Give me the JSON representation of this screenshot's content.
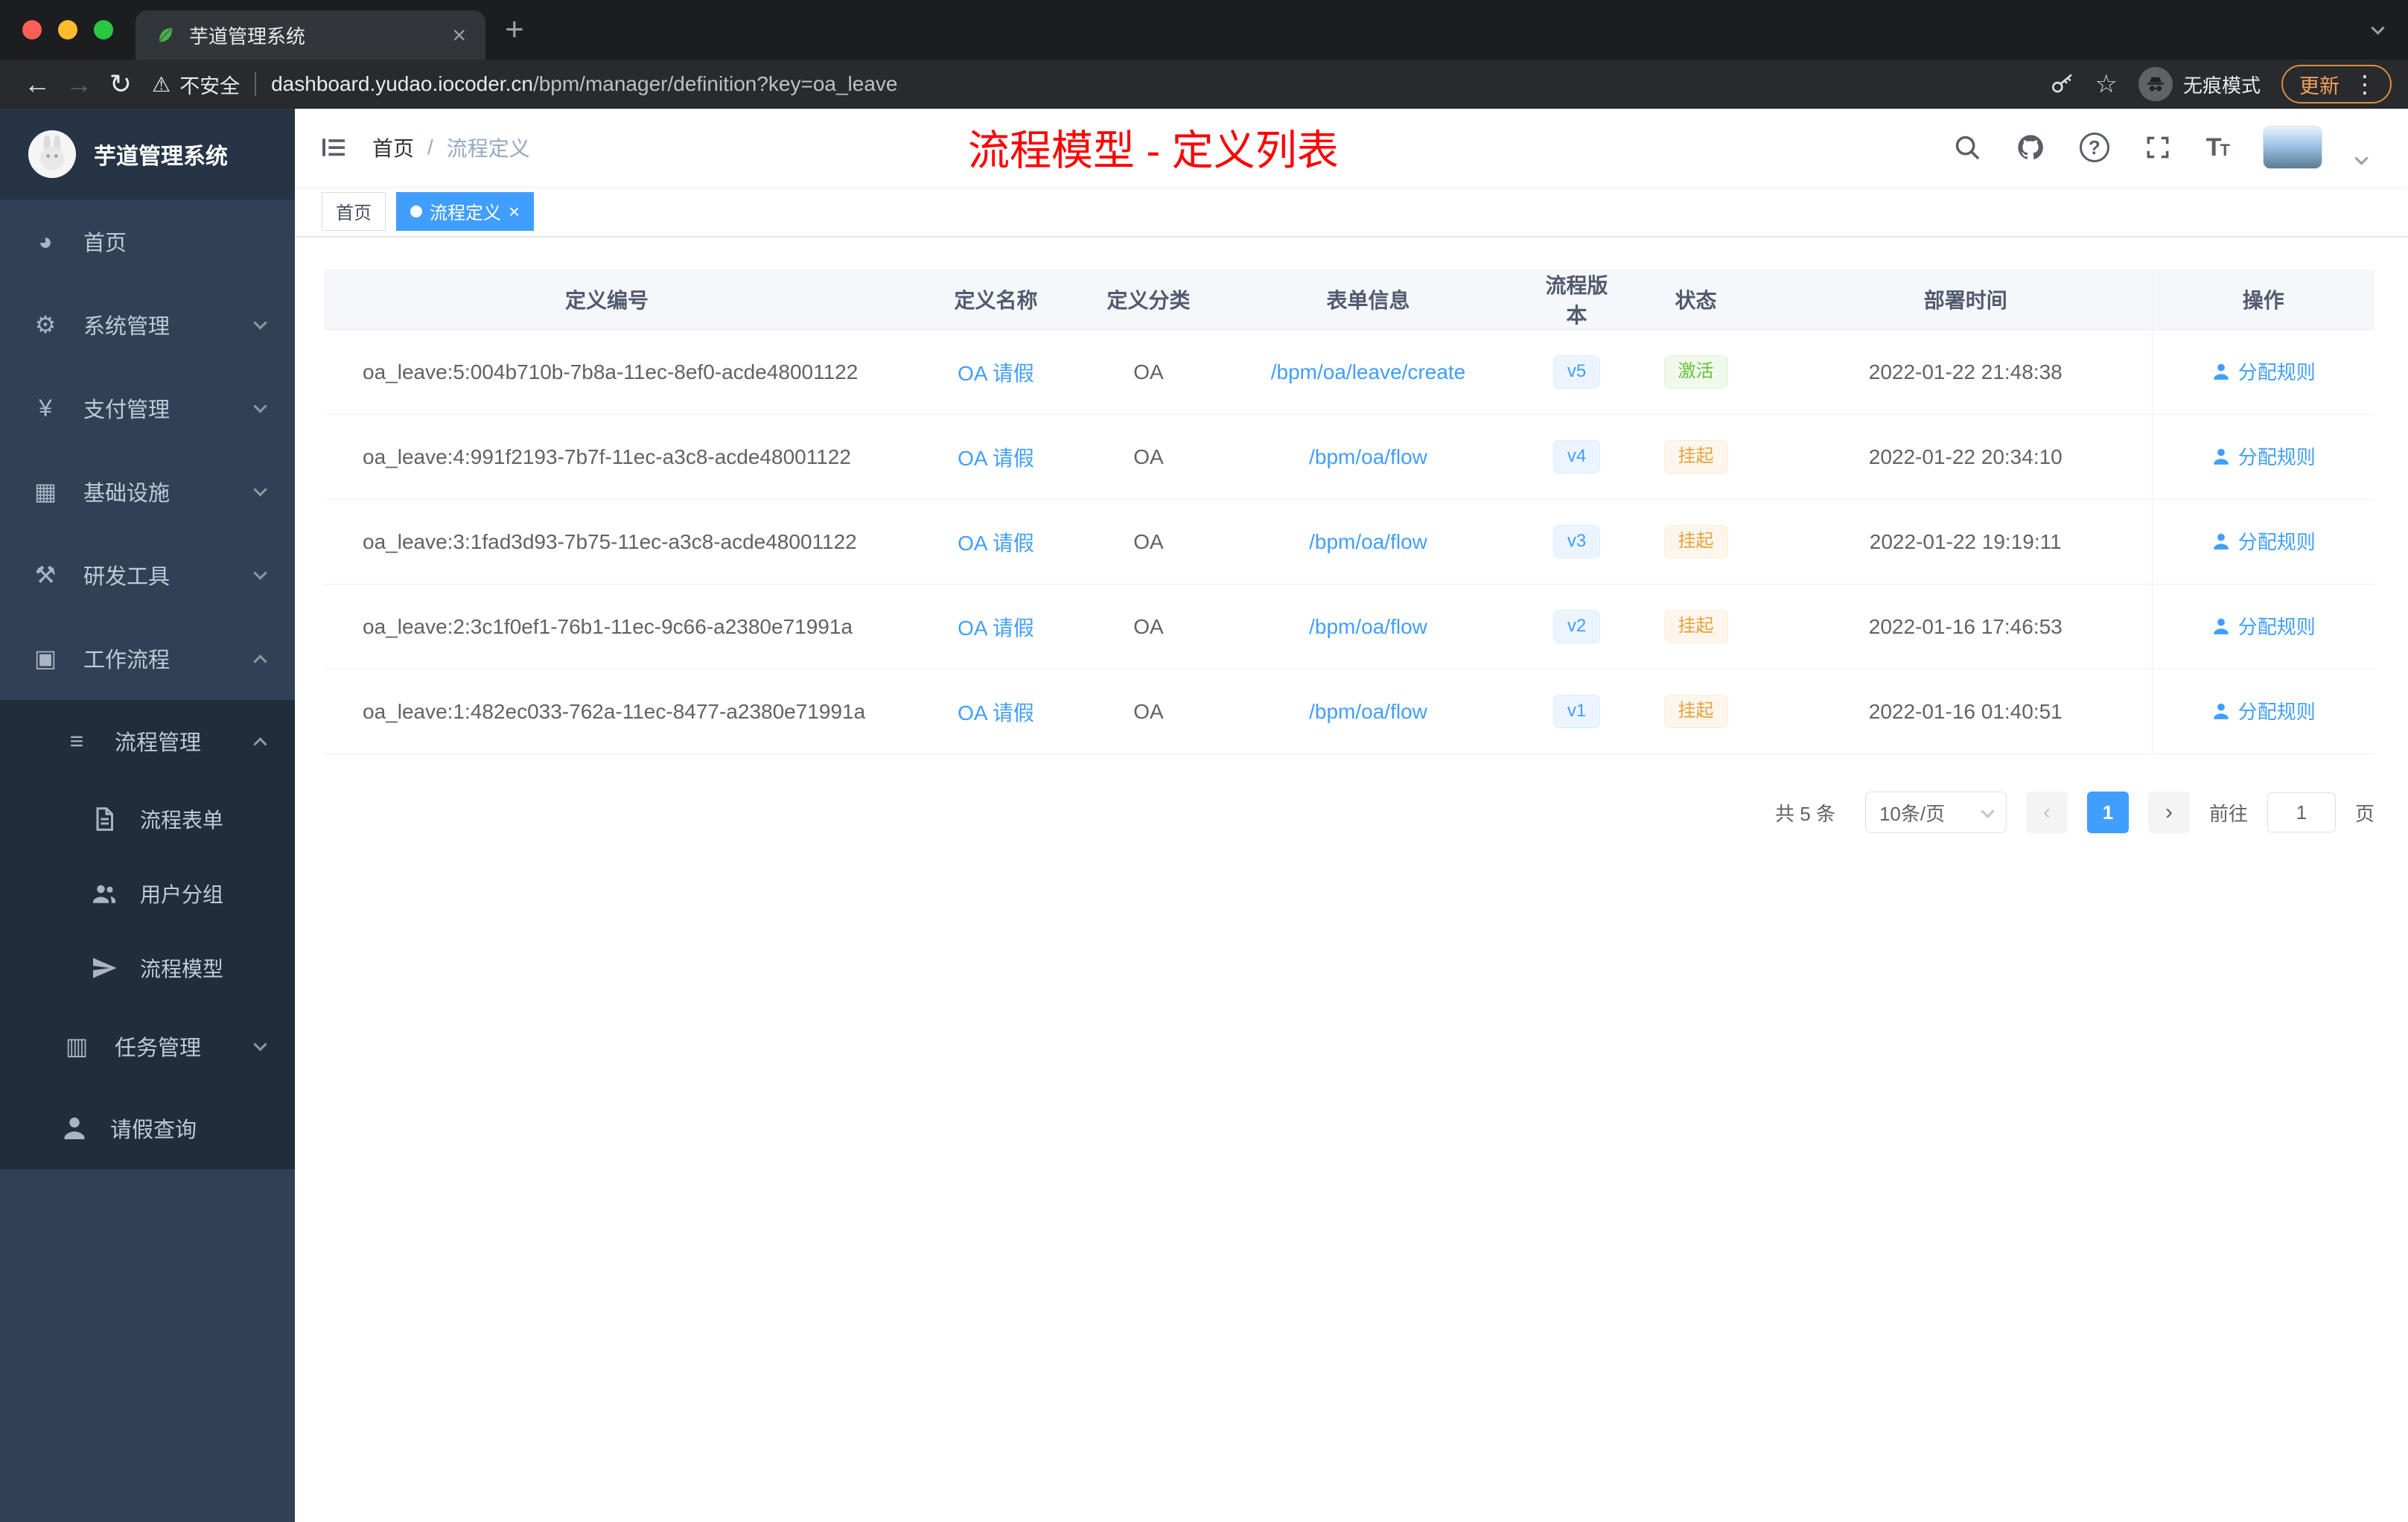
{
  "colors": {
    "accent": "#409eff",
    "success": "#67c23a",
    "warning": "#e6a23c",
    "annotation_red": "#fe0000",
    "sidebar_bg": "#304156",
    "submenu_bg": "#1f2d3d"
  },
  "browser": {
    "tab_title": "芋道管理系统",
    "security_label": "不安全",
    "url_domain": "dashboard.yudao.iocoder.cn",
    "url_path": "/bpm/manager/definition?key=oa_leave",
    "incognito_label": "无痕模式",
    "update_label": "更新"
  },
  "icons": {
    "dashboard": "◕",
    "system": "⚙",
    "payment": "¥",
    "infrastructure": "▦",
    "devtools": "⚒",
    "workflow": "▣",
    "process_management": "≡",
    "task_management": "▥",
    "back": "←",
    "forward": "→",
    "reload": "↻",
    "warning": "⚠",
    "star": "☆",
    "plus": "+",
    "close": "×",
    "dots": "⋮"
  },
  "sidebar": {
    "title": "芋道管理系统",
    "items": [
      {
        "label": "首页"
      },
      {
        "label": "系统管理"
      },
      {
        "label": "支付管理"
      },
      {
        "label": "基础设施"
      },
      {
        "label": "研发工具"
      },
      {
        "label": "工作流程"
      }
    ],
    "process_group": {
      "label": "流程管理",
      "children": [
        {
          "label": "流程表单"
        },
        {
          "label": "用户分组"
        },
        {
          "label": "流程模型"
        }
      ]
    },
    "task_group": {
      "label": "任务管理"
    },
    "leave_item": {
      "label": "请假查询"
    }
  },
  "header": {
    "breadcrumb_home": "首页",
    "breadcrumb_current": "流程定义",
    "annotation": "流程模型 - 定义列表"
  },
  "tags": {
    "home": "首页",
    "active": "流程定义"
  },
  "table": {
    "columns": [
      "定义编号",
      "定义名称",
      "定义分类",
      "表单信息",
      "流程版本",
      "状态",
      "部署时间",
      "操作"
    ],
    "rows": [
      {
        "id": "oa_leave:5:004b710b-7b8a-11ec-8ef0-acde48001122",
        "name": "OA 请假",
        "category": "OA",
        "form": "/bpm/oa/leave/create",
        "version": "v5",
        "status": "激活",
        "time": "2022-01-22 21:48:38",
        "action": "分配规则"
      },
      {
        "id": "oa_leave:4:991f2193-7b7f-11ec-a3c8-acde48001122",
        "name": "OA 请假",
        "category": "OA",
        "form": "/bpm/oa/flow",
        "version": "v4",
        "status": "挂起",
        "time": "2022-01-22 20:34:10",
        "action": "分配规则"
      },
      {
        "id": "oa_leave:3:1fad3d93-7b75-11ec-a3c8-acde48001122",
        "name": "OA 请假",
        "category": "OA",
        "form": "/bpm/oa/flow",
        "version": "v3",
        "status": "挂起",
        "time": "2022-01-22 19:19:11",
        "action": "分配规则"
      },
      {
        "id": "oa_leave:2:3c1f0ef1-76b1-11ec-9c66-a2380e71991a",
        "name": "OA 请假",
        "category": "OA",
        "form": "/bpm/oa/flow",
        "version": "v2",
        "status": "挂起",
        "time": "2022-01-16 17:46:53",
        "action": "分配规则"
      },
      {
        "id": "oa_leave:1:482ec033-762a-11ec-8477-a2380e71991a",
        "name": "OA 请假",
        "category": "OA",
        "form": "/bpm/oa/flow",
        "version": "v1",
        "status": "挂起",
        "time": "2022-01-16 01:40:51",
        "action": "分配规则"
      }
    ]
  },
  "pagination": {
    "total": "共 5 条",
    "page_size": "10条/页",
    "prev": "‹",
    "next": "›",
    "current": "1",
    "goto_label": "前往",
    "goto_value": "1",
    "page_unit": "页"
  }
}
